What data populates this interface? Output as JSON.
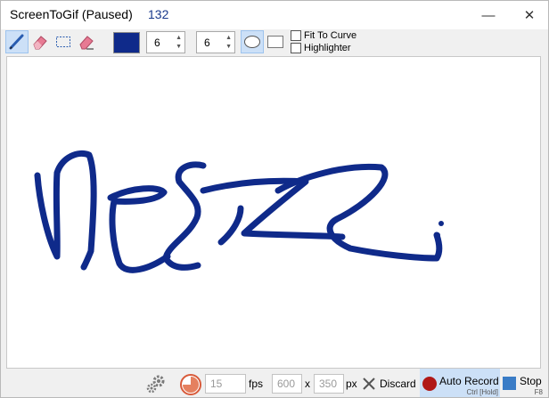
{
  "window": {
    "title": "ScreenToGif (Paused)",
    "frame_count": "132"
  },
  "titlebar": {
    "minimize_glyph": "—",
    "close_glyph": "✕"
  },
  "toolbar": {
    "tools": [
      "pen-icon",
      "eraser-icon",
      "select-icon",
      "clear-eraser-icon"
    ],
    "active_tool": "pen-icon",
    "color": "#0f2a8a",
    "width_value": "6",
    "height_value": "6",
    "shapes": [
      "ellipse",
      "rectangle"
    ],
    "active_shape": "ellipse",
    "fit_to_curve_label": "Fit To Curve",
    "highlighter_label": "Highlighter",
    "fit_to_curve_checked": false,
    "highlighter_checked": false
  },
  "canvas": {
    "stroke_color": "#0f2a8a",
    "background": "#ffffff"
  },
  "bottombar": {
    "fps_value": "15",
    "fps_label": "fps",
    "width_value": "600",
    "times_label": "x",
    "height_value": "350",
    "px_label": "px",
    "discard_label": "Discard",
    "auto_record_label": "Auto Record",
    "auto_record_shortcut": "Ctrl [Hold]",
    "stop_label": "Stop",
    "stop_shortcut": "F8",
    "record_color": "#b01818",
    "stop_color": "#3a7cc6"
  }
}
